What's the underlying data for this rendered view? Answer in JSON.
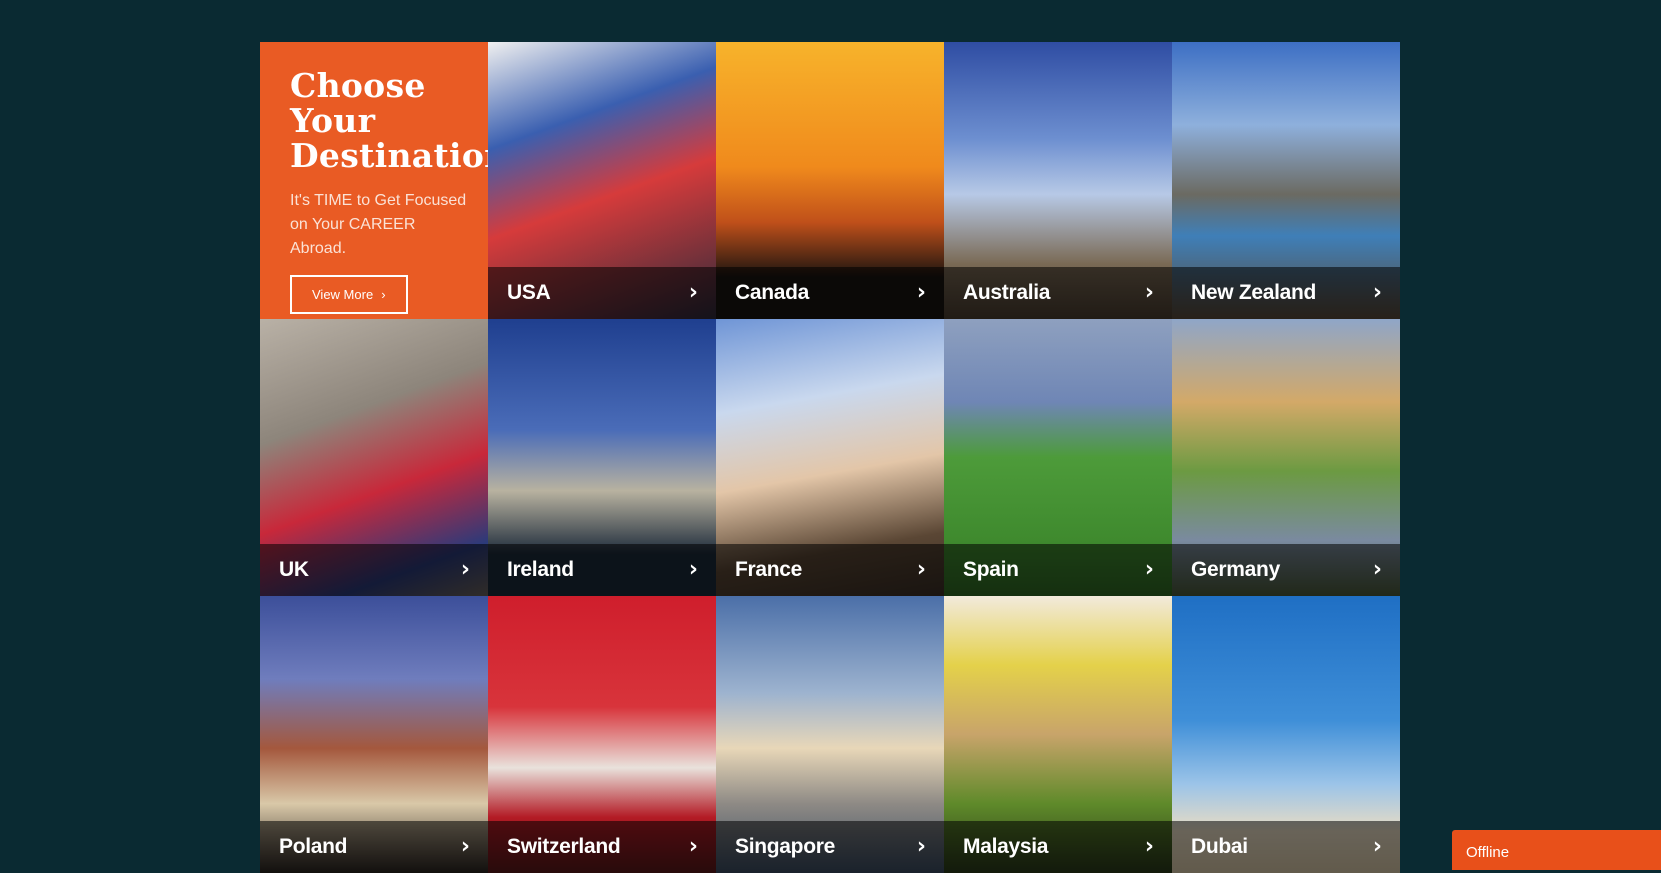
{
  "promo": {
    "title": "Choose Your Destination",
    "subtitle": "It's TIME to Get Focused on Your CAREER Abroad.",
    "button_label": "View More",
    "button_icon": "chevron-right-icon"
  },
  "destinations": [
    {
      "name": "USA",
      "icon": "chevron-right-icon"
    },
    {
      "name": "Canada",
      "icon": "chevron-right-icon"
    },
    {
      "name": "Australia",
      "icon": "chevron-right-icon"
    },
    {
      "name": "New Zealand",
      "icon": "chevron-right-icon"
    },
    {
      "name": "UK",
      "icon": "chevron-right-icon"
    },
    {
      "name": "Ireland",
      "icon": "chevron-right-icon"
    },
    {
      "name": "France",
      "icon": "chevron-right-icon"
    },
    {
      "name": "Spain",
      "icon": "chevron-right-icon"
    },
    {
      "name": "Germany",
      "icon": "chevron-right-icon"
    },
    {
      "name": "Poland",
      "icon": "chevron-right-icon"
    },
    {
      "name": "Switzerland",
      "icon": "chevron-right-icon"
    },
    {
      "name": "Singapore",
      "icon": "chevron-right-icon"
    },
    {
      "name": "Malaysia",
      "icon": "chevron-right-icon"
    },
    {
      "name": "Dubai",
      "icon": "chevron-right-icon"
    }
  ],
  "chat_widget": {
    "status": "Offline"
  },
  "colors": {
    "background": "#0a2a32",
    "accent": "#e95b24",
    "chat": "#e8501a"
  }
}
